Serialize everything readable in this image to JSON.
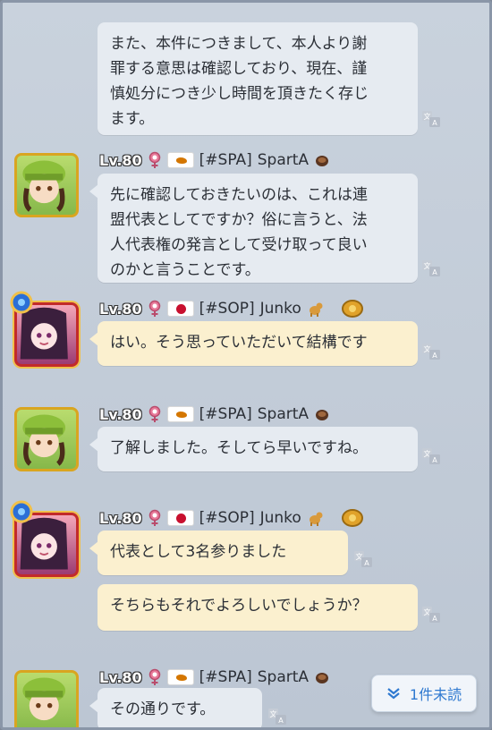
{
  "messages": [
    {
      "text_lines": [
        "また、本件につきまして、本人より謝",
        "罪する意思は確認しており、現在、謹",
        "慎処分につき少し時間を頂きたく存じ",
        "ます。"
      ]
    },
    {
      "header": {
        "level": "Lv.80",
        "tag": "[#SPA]",
        "name": "SpartA"
      },
      "text_lines": [
        "先に確認しておきたいのは、これは連",
        "盟代表としてですか？俗に言うと、法",
        "人代表権の発言として受け取って良い",
        "のかと言うことです。"
      ]
    },
    {
      "header": {
        "level": "Lv.80",
        "tag": "[#SOP]",
        "name": "Junko"
      },
      "text_lines": [
        "はい。そう思っていただいて結構です"
      ]
    },
    {
      "header": {
        "level": "Lv.80",
        "tag": "[#SPA]",
        "name": "SpartA"
      },
      "text_lines": [
        "了解しました。そしてら早いですね。"
      ]
    },
    {
      "header": {
        "level": "Lv.80",
        "tag": "[#SOP]",
        "name": "Junko"
      },
      "text_lines": [
        "代表として3名参りました"
      ]
    },
    {
      "text_lines": [
        "そちらもそれでよろしいでしょうか？"
      ]
    },
    {
      "header": {
        "level": "Lv.80",
        "tag": "[#SPA]",
        "name": "SpartA"
      },
      "text_lines": [
        "その通りです。"
      ]
    }
  ],
  "unread_button": {
    "label": "1件未読"
  },
  "colors": {
    "blue_bubble": "#e6ebf1",
    "yellow_bubble": "#fbf0cf",
    "accent": "#2f79d0"
  },
  "icons": [
    "translate-icon",
    "female-icon",
    "flag-cyprus-icon",
    "flag-japan-icon",
    "coffee-icon",
    "dog-icon",
    "crest-badge-icon",
    "chevron-double-down-icon"
  ]
}
